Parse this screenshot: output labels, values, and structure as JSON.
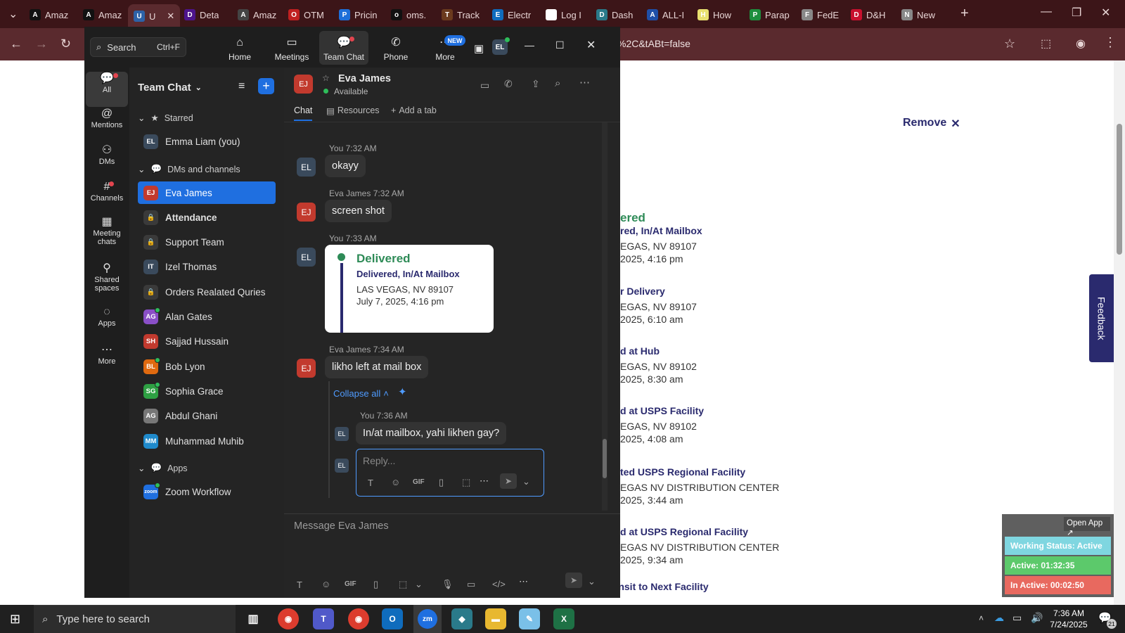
{
  "browser": {
    "tabs": [
      {
        "label": "Amaz",
        "icon": "amazon-icon",
        "color": "#111"
      },
      {
        "label": "Amaz",
        "icon": "amazon-icon",
        "color": "#111"
      },
      {
        "label": "U",
        "icon": "ups-icon",
        "color": "#2d62a8"
      },
      {
        "label": "Deta",
        "icon": "fedex-icon",
        "color": "#4d148c"
      },
      {
        "label": "Amaz",
        "icon": "amazon-icon",
        "color": "#444"
      },
      {
        "label": "OTM",
        "icon": "otm-icon",
        "color": "#c02020"
      },
      {
        "label": "Pricin",
        "icon": "dollar-icon",
        "color": "#1e6fd9"
      },
      {
        "label": "oms.",
        "icon": "oms-icon",
        "color": "#111"
      },
      {
        "label": "Track",
        "icon": "ups-icon",
        "color": "#6b3a1e"
      },
      {
        "label": "Electr",
        "icon": "ec-icon",
        "color": "#0f6cbd"
      },
      {
        "label": "Log I",
        "icon": "login-icon",
        "color": "#fff"
      },
      {
        "label": "Dash",
        "icon": "dashboard-icon",
        "color": "#2a7a8a"
      },
      {
        "label": "ALL-I",
        "icon": "17track-icon",
        "color": "#1f4fa8"
      },
      {
        "label": "How",
        "icon": "howto-icon",
        "color": "#e8e070"
      },
      {
        "label": "Parap",
        "icon": "sheets-icon",
        "color": "#1e8e3e"
      },
      {
        "label": "FedE",
        "icon": "fedex-globe-icon",
        "color": "#888"
      },
      {
        "label": "D&H",
        "icon": "dh-icon",
        "color": "#c8102e"
      },
      {
        "label": "New",
        "icon": "chrome-icon",
        "color": "#888"
      }
    ],
    "url": "%2C&tABt=false"
  },
  "page": {
    "remove_label": "Remove",
    "events": [
      {
        "status": "ered",
        "detail": "red, In/At Mailbox",
        "loc": "EGAS, NV 89107",
        "time": "2025, 4:16 pm",
        "status_color": "#2e8b57"
      },
      {
        "status": "r Delivery",
        "detail": "",
        "loc": "EGAS, NV 89107",
        "time": "2025, 6:10 am",
        "status_color": "#2a2a6e"
      },
      {
        "status": "d at Hub",
        "detail": "",
        "loc": "EGAS, NV 89102",
        "time": "2025, 8:30 am",
        "status_color": "#2a2a6e"
      },
      {
        "status": "d at USPS Facility",
        "detail": "",
        "loc": "EGAS, NV 89102",
        "time": "2025, 4:08 am",
        "status_color": "#2a2a6e"
      },
      {
        "status": "ted USPS Regional Facility",
        "detail": "",
        "loc": "EGAS NV DISTRIBUTION CENTER",
        "time": "2025, 3:44 am",
        "status_color": "#2a2a6e"
      },
      {
        "status": "d at USPS Regional Facility",
        "detail": "",
        "loc": "EGAS NV DISTRIBUTION CENTER",
        "time": "2025, 9:34 am",
        "status_color": "#2a2a6e"
      },
      {
        "status": "In Transit to Next Facility",
        "detail": "",
        "loc": "",
        "time": "",
        "status_color": "#2a2a6e"
      }
    ],
    "feedback_label": "Feedback",
    "widget": {
      "open_app": "Open App ↗",
      "working_status": "Working Status: Active",
      "active": "Active: 01:32:35",
      "inactive": "In Active: 00:02:50"
    }
  },
  "zoom": {
    "search_placeholder": "Search",
    "search_shortcut": "Ctrl+F",
    "nav": [
      {
        "label": "Home",
        "icon": "home-icon"
      },
      {
        "label": "Meetings",
        "icon": "video-icon"
      },
      {
        "label": "Team Chat",
        "icon": "chat-icon"
      },
      {
        "label": "Phone",
        "icon": "phone-icon"
      },
      {
        "label": "More",
        "icon": "more-icon"
      }
    ],
    "new_badge": "NEW",
    "user_initials": "EL",
    "rail": [
      {
        "label": "All",
        "icon": "chat-bubble-icon"
      },
      {
        "label": "Mentions",
        "icon": "at-icon"
      },
      {
        "label": "DMs",
        "icon": "people-icon"
      },
      {
        "label": "Channels",
        "icon": "hash-icon"
      },
      {
        "label": "Meeting chats",
        "icon": "calendar-icon"
      },
      {
        "label": "Shared spaces",
        "icon": "share-icon"
      },
      {
        "label": "Apps",
        "icon": "apps-icon"
      },
      {
        "label": "More",
        "icon": "ellipsis-icon"
      }
    ],
    "sidebar": {
      "title": "Team Chat",
      "starred_label": "Starred",
      "starred": [
        {
          "name": "Emma Liam (you)",
          "initials": "EL",
          "color": "#3a4a5c"
        }
      ],
      "dm_label": "DMs and channels",
      "channels": [
        {
          "name": "Eva James",
          "initials": "EJ",
          "color": "#c23a2e",
          "presence": false
        },
        {
          "name": "Attendance",
          "initials": "🔒",
          "color": "#3a3a3a",
          "presence": false
        },
        {
          "name": "Support Team",
          "initials": "🔒",
          "color": "#3a3a3a",
          "presence": false
        },
        {
          "name": "Izel Thomas",
          "initials": "IT",
          "color": "#3a4a5c",
          "presence": false
        },
        {
          "name": "Orders Realated Quries",
          "initials": "🔒",
          "color": "#3a3a3a",
          "presence": false
        },
        {
          "name": "Alan Gates",
          "initials": "AG",
          "color": "#8a4fc7",
          "presence": true
        },
        {
          "name": "Sajjad Hussain",
          "initials": "SH",
          "color": "#c23a2e",
          "presence": false
        },
        {
          "name": "Bob Lyon",
          "initials": "BL",
          "color": "#e06a10",
          "presence": true
        },
        {
          "name": "Sophia Grace",
          "initials": "SG",
          "color": "#2ea043",
          "presence": true
        },
        {
          "name": "Abdul Ghani",
          "initials": "AG",
          "color": "#777",
          "presence": false
        },
        {
          "name": "Muhammad Muhib",
          "initials": "MM",
          "color": "#1f8acb",
          "presence": false
        }
      ],
      "apps_label": "Apps",
      "apps": [
        {
          "name": "Zoom Workflow",
          "initials": "zoom",
          "color": "#1f6fe0",
          "presence": true
        }
      ]
    },
    "chat": {
      "contact_name": "Eva James",
      "contact_initials": "EJ",
      "contact_status": "Available",
      "tabs": [
        "Chat",
        "Resources",
        "Add a tab"
      ],
      "messages": [
        {
          "meta": "You 7:32 AM",
          "text": "okayy",
          "initials": "EL"
        },
        {
          "meta": "Eva James 7:32 AM",
          "text": "screen shot",
          "initials": "EJ"
        },
        {
          "meta": "You 7:33 AM",
          "text": "",
          "initials": "EL"
        },
        {
          "meta": "Eva James 7:34 AM",
          "text": "likho left at mail box",
          "initials": "EJ"
        }
      ],
      "screenshot_card": {
        "status": "Delivered",
        "detail": "Delivered, In/At Mailbox",
        "loc": "LAS VEGAS, NV 89107",
        "time": "July 7, 2025, 4:16 pm"
      },
      "collapse_label": "Collapse all",
      "reply": {
        "meta": "You 7:36 AM",
        "text": "In/at mailbox, yahi likhen gay?",
        "initials": "EL"
      },
      "reply_placeholder": "Reply...",
      "composer_placeholder": "Message Eva James"
    }
  },
  "taskbar": {
    "search_placeholder": "Type here to search",
    "time": "7:36 AM",
    "date": "7/24/2025",
    "notif_count": "21"
  }
}
